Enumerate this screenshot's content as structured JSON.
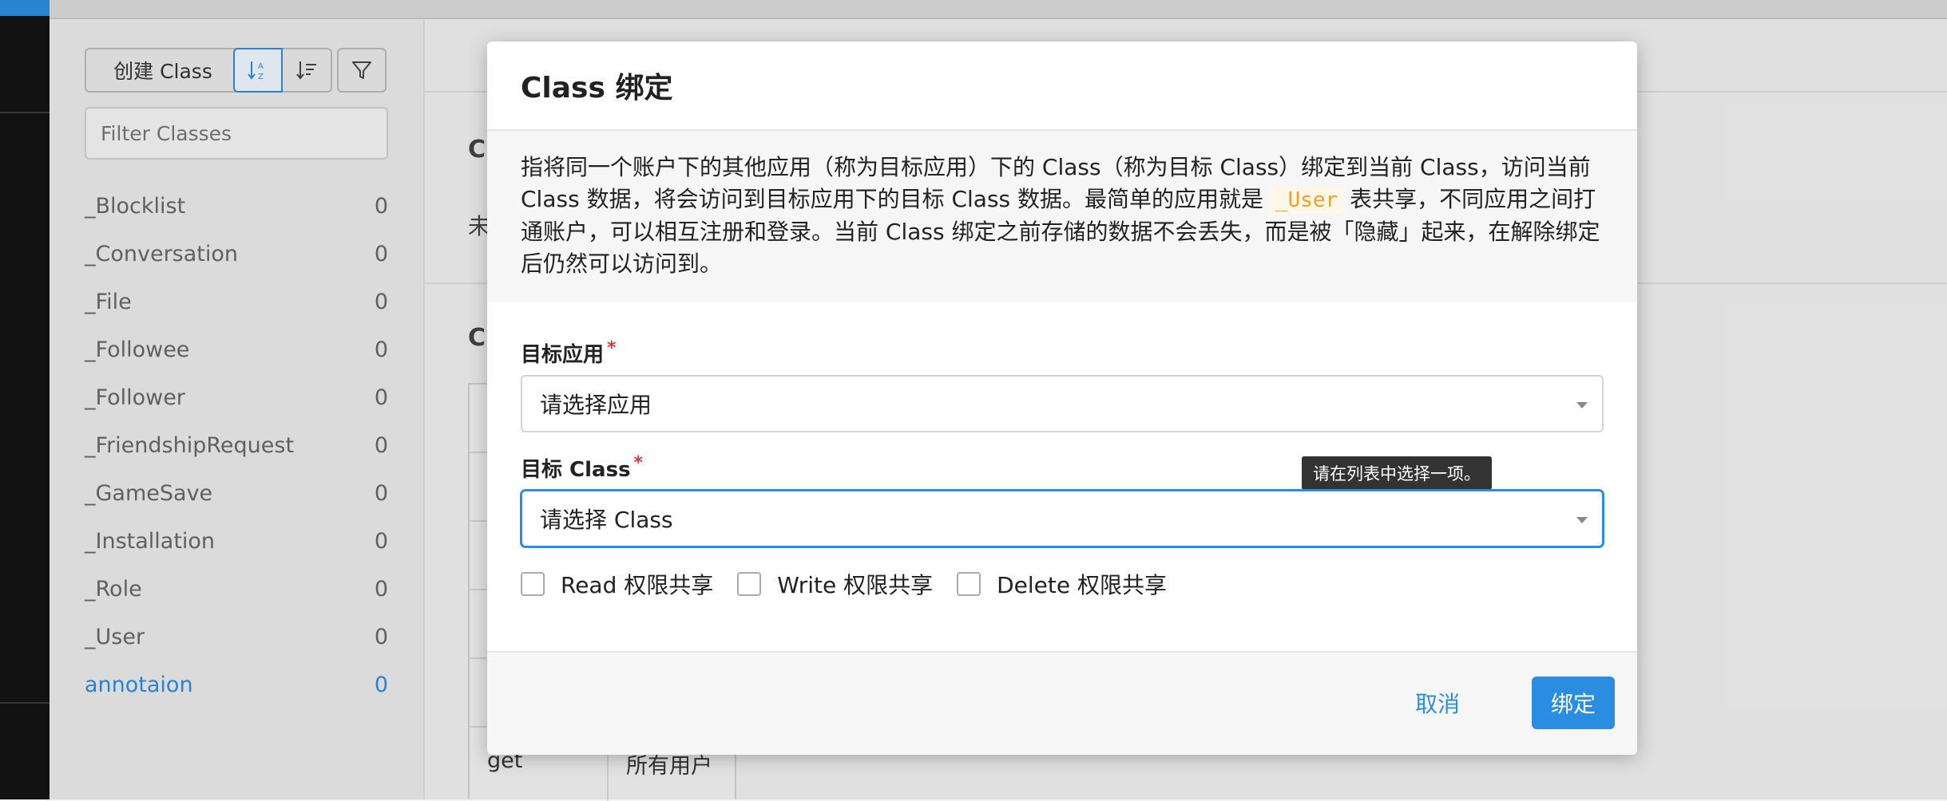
{
  "sidebar": {
    "create_button": "创建 Class",
    "filter_placeholder": "Filter Classes",
    "classes": [
      {
        "name": "_Blocklist",
        "count": "0"
      },
      {
        "name": "_Conversation",
        "count": "0"
      },
      {
        "name": "_File",
        "count": "0"
      },
      {
        "name": "_Followee",
        "count": "0"
      },
      {
        "name": "_Follower",
        "count": "0"
      },
      {
        "name": "_FriendshipRequest",
        "count": "0"
      },
      {
        "name": "_GameSave",
        "count": "0"
      },
      {
        "name": "_Installation",
        "count": "0"
      },
      {
        "name": "_Role",
        "count": "0"
      },
      {
        "name": "_User",
        "count": "0"
      },
      {
        "name": "annotaion",
        "count": "0"
      }
    ],
    "active_class": "annotaion"
  },
  "background": {
    "frag_c1": "C",
    "frag_wei": "未",
    "frag_c2": "C",
    "table_cell_get": "get",
    "table_cell_all_users": "所有用户"
  },
  "dialog": {
    "title": "Class 绑定",
    "desc_part1": "指将同一个账户下的其他应用（称为目标应用）下的 Class（称为目标 Class）绑定到当前 Class，访问当前 Class 数据，将会访问到目标应用下的目标 Class 数据。最简单的应用就是 ",
    "desc_code": "_User",
    "desc_part2": " 表共享，不同应用之间打通账户，可以相互注册和登录。当前 Class 绑定之前存储的数据不会丢失，而是被「隐藏」起来，在解除绑定后仍然可以访问到。",
    "target_app_label": "目标应用",
    "target_app_value": "请选择应用",
    "target_class_label": "目标 Class",
    "target_class_value": "请选择 Class",
    "required_mark": "*",
    "tooltip": "请在列表中选择一项。",
    "checkboxes": [
      {
        "label": "Read 权限共享",
        "checked": false
      },
      {
        "label": "Write 权限共享",
        "checked": false
      },
      {
        "label": "Delete 权限共享",
        "checked": false
      }
    ],
    "cancel_label": "取消",
    "confirm_label": "绑定"
  },
  "colors": {
    "accent": "#2b8de1",
    "code_text": "#f0a020",
    "required": "#d9363e"
  }
}
